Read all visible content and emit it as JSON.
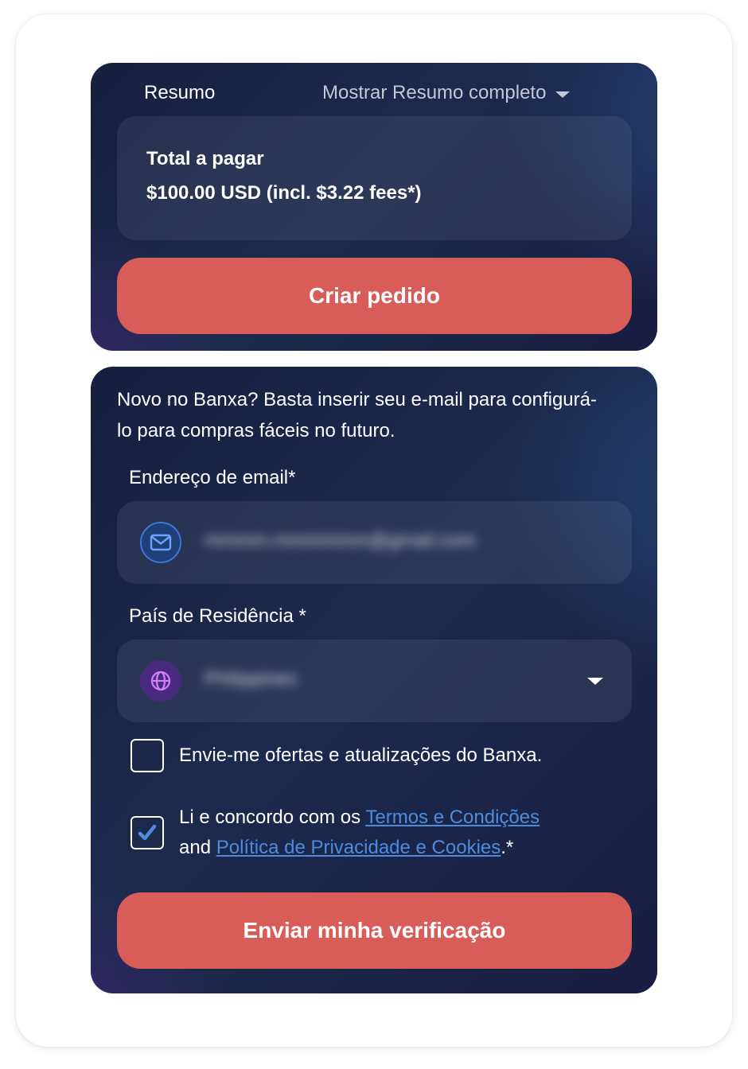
{
  "summary": {
    "label": "Resumo",
    "toggle_label": "Mostrar Resumo completo",
    "total_title": "Total a pagar",
    "total_value": "$100.00 USD (incl. $3.22 fees*)",
    "create_button": "Criar pedido"
  },
  "form": {
    "intro": "Novo no Banxa? Basta inserir seu e-mail para configurá-lo para compras fáceis no futuro.",
    "email_label": "Endereço de email*",
    "email_value": "mmmm.mmmmmm@gmail.com",
    "country_label": "País de Residência *",
    "country_value": "Philippines",
    "offers_checkbox": {
      "label": "Envie-me ofertas e atualizações do Banxa.",
      "checked": false
    },
    "terms_checkbox": {
      "prefix": "Li e concordo com os ",
      "terms_link": "Termos e Condições",
      "middle": "and ",
      "privacy_link": "Política de Privacidade e Cookies",
      "suffix": ".*",
      "checked": true
    },
    "submit_button": "Enviar minha verificação"
  },
  "colors": {
    "accent_button": "#d85c58",
    "link": "#4f8bdc",
    "card_background": "#1b2a4d"
  },
  "icons": {
    "email": "mail-icon",
    "country": "globe-icon",
    "dropdown": "chevron-down-icon",
    "check": "checkmark-icon"
  }
}
